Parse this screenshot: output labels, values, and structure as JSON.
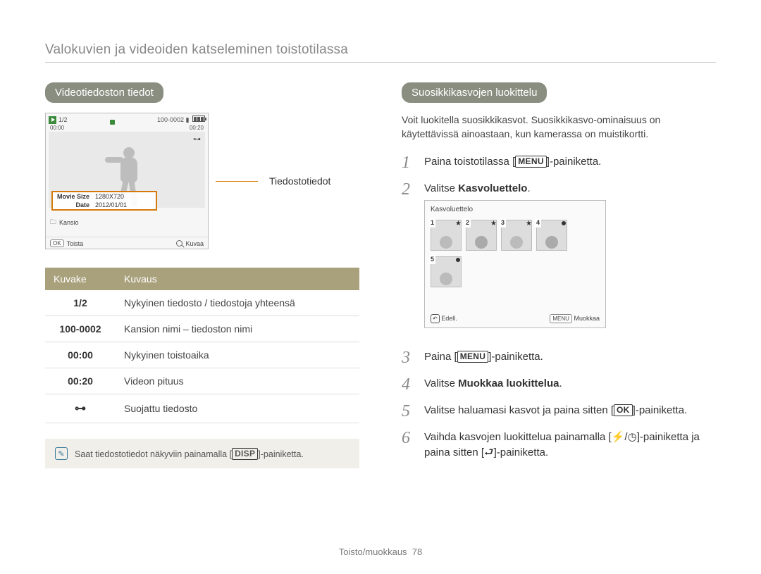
{
  "page_title": "Valokuvien ja videoiden katseleminen toistotilassa",
  "footer": {
    "section": "Toisto/muokkaus",
    "page": "78"
  },
  "left": {
    "heading": "Videotiedoston tiedot",
    "lcd": {
      "file_index": "1/2",
      "folder_file": "100-0002",
      "mem_icon": "memory-card-icon",
      "batt_icon": "battery-icon",
      "time_current": "00:00",
      "time_total": "00:20",
      "lock_icon": "lock-icon",
      "info": {
        "row1_label": "Movie Size",
        "row1_value": "1280X720",
        "row2_label": "Date",
        "row2_value": "2012/01/01"
      },
      "bottom": {
        "folder_label": "Kansio",
        "ok_label": "OK",
        "play_label": "Toista",
        "zoom_label": "Kuvaa"
      }
    },
    "callout": "Tiedostotiedot",
    "table": {
      "head_icon": "Kuvake",
      "head_desc": "Kuvaus",
      "rows": [
        {
          "icon": "1/2",
          "desc": "Nykyinen tiedosto / tiedostoja yhteensä"
        },
        {
          "icon": "100-0002",
          "desc": "Kansion nimi – tiedoston nimi"
        },
        {
          "icon": "00:00",
          "desc": "Nykyinen toistoaika"
        },
        {
          "icon": "00:20",
          "desc": "Videon pituus"
        },
        {
          "icon": "lock",
          "desc": "Suojattu tiedosto"
        }
      ]
    },
    "tip_pre": "Saat tiedostotiedot näkyviin painamalla [",
    "tip_btn": "DISP",
    "tip_post": "]-painiketta."
  },
  "right": {
    "heading": "Suosikkikasvojen luokittelu",
    "intro": "Voit luokitella suosikkikasvot. Suosikkikasvo-ominaisuus on käytettävissä ainoastaan, kun kamerassa on muistikortti.",
    "steps": {
      "s1_pre": "Paina toistotilassa [",
      "s1_btn": "MENU",
      "s1_post": "]-painiketta.",
      "s2_pre": "Valitse ",
      "s2_bold": "Kasvoluettelo",
      "s2_post": ".",
      "s3_pre": "Paina [",
      "s3_btn": "MENU",
      "s3_post": "]-painiketta.",
      "s4_pre": "Valitse ",
      "s4_bold": "Muokkaa luokittelua",
      "s4_post": ".",
      "s5_pre": "Valitse haluamasi kasvot ja paina sitten [",
      "s5_btn": "OK",
      "s5_post": "]-painiketta.",
      "s6_pre": "Vaihda kasvojen luokittelua painamalla [",
      "s6_mid": "]-painiketta ja paina sitten [",
      "s6_post": "]-painiketta."
    },
    "facelcd": {
      "title": "Kasvoluettelo",
      "faces": [
        {
          "n": "1",
          "mark": "star"
        },
        {
          "n": "2",
          "mark": "star"
        },
        {
          "n": "3",
          "mark": "star"
        },
        {
          "n": "4",
          "mark": "dot"
        },
        {
          "n": "5",
          "mark": "dot"
        }
      ],
      "back_label": "Edell.",
      "menu_btn": "MENU",
      "menu_label": "Muokkaa"
    }
  }
}
